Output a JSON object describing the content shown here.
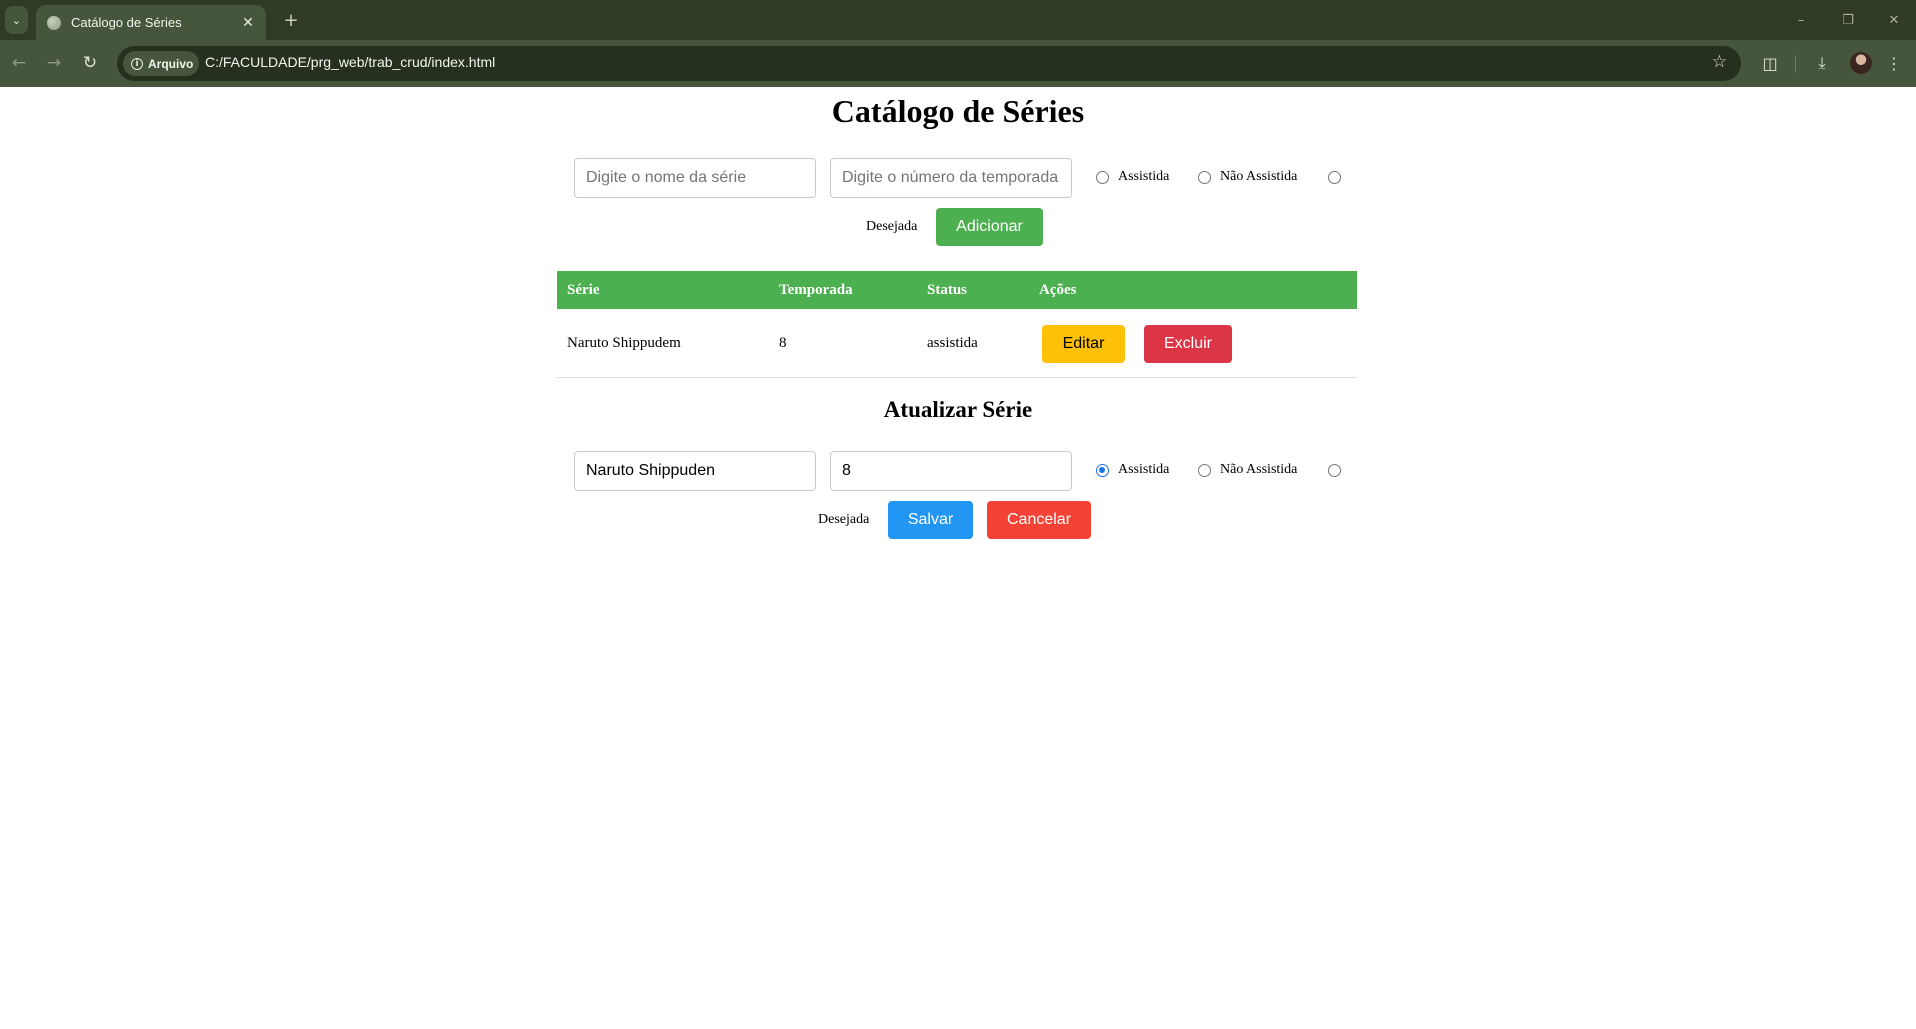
{
  "browser": {
    "tab_title": "Catálogo de Séries",
    "chip_label": "Arquivo",
    "url": "C:/FACULDADE/prg_web/trab_crud/index.html"
  },
  "page": {
    "title": "Catálogo de Séries",
    "add_form": {
      "name_placeholder": "Digite o nome da série",
      "season_placeholder": "Digite o número da temporada",
      "radio_watched": "Assistida",
      "radio_not_watched": "Não Assistida",
      "radio_wanted": "Desejada",
      "selected_status": "",
      "add_button": "Adicionar"
    },
    "table": {
      "headers": [
        "Série",
        "Temporada",
        "Status",
        "Ações"
      ],
      "rows": [
        {
          "serie": "Naruto Shippudem",
          "temporada": "8",
          "status": "assistida"
        }
      ],
      "edit_button": "Editar",
      "delete_button": "Excluir"
    },
    "update_form": {
      "title": "Atualizar Série",
      "name_value": "Naruto Shippuden",
      "season_value": "8",
      "radio_watched": "Assistida",
      "radio_not_watched": "Não Assistida",
      "radio_wanted": "Desejada",
      "selected_status": "Assistida",
      "save_button": "Salvar",
      "cancel_button": "Cancelar"
    }
  },
  "colors": {
    "accent_green": "#4caf50",
    "edit_yellow": "#ffc107",
    "delete_red": "#dc3545",
    "save_blue": "#2196f3",
    "cancel_red": "#f44336",
    "radio_selected": "#1a73e8"
  }
}
